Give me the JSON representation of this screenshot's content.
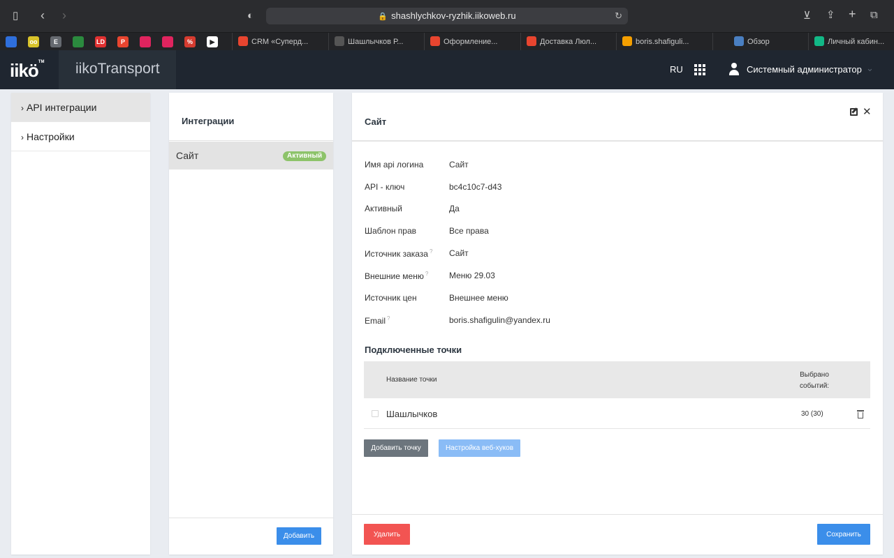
{
  "browser": {
    "url": "shashlychkov-ryzhik.iikoweb.ru",
    "pinned": [
      {
        "label": "",
        "color": "#2f6fdb"
      },
      {
        "label": "oo",
        "color": "#d9c32a"
      },
      {
        "label": "E",
        "color": "#666a70"
      },
      {
        "label": "",
        "color": "#2b8a3e"
      },
      {
        "label": "LD",
        "color": "#e03131"
      },
      {
        "label": "P",
        "color": "#e8452f"
      },
      {
        "label": "",
        "color": "#e0245e"
      },
      {
        "label": "",
        "color": "#e0245e"
      },
      {
        "label": "%",
        "color": "#d63b2f"
      },
      {
        "label": "▶",
        "color": "#ffffff"
      }
    ],
    "tabs": [
      {
        "label": "CRM «Суперд...",
        "color": "#e8452f"
      },
      {
        "label": "Шашлычков Р...",
        "color": "#555555"
      },
      {
        "label": "Оформление...",
        "color": "#e8452f"
      },
      {
        "label": "Доставка Люл...",
        "color": "#e8452f"
      },
      {
        "label": "boris.shafigulі...",
        "color": "#f59f00"
      },
      {
        "label": "Обзор",
        "color": "#4a7fc1"
      },
      {
        "label": "Личный кабин...",
        "color": "#12b886"
      }
    ]
  },
  "header": {
    "logo": "iikö",
    "logo_tm": "TM",
    "app_name": "iikoTransport",
    "lang": "RU",
    "user": "Системный администратор"
  },
  "sidebar": {
    "items": [
      {
        "label": "API интеграции"
      },
      {
        "label": "Настройки"
      }
    ]
  },
  "integrations": {
    "title": "Интеграции",
    "items": [
      {
        "label": "Сайт",
        "badge": "Активный"
      }
    ],
    "add_button": "Добавить"
  },
  "detail": {
    "title": "Сайт",
    "fields": [
      {
        "label": "Имя api логина",
        "value": "Сайт",
        "help": ""
      },
      {
        "label": "API - ключ",
        "value": "bc4c10c7-d43",
        "help": ""
      },
      {
        "label": "Активный",
        "value": "Да",
        "help": ""
      },
      {
        "label": "Шаблон прав",
        "value": "Все права",
        "help": ""
      },
      {
        "label": "Источник заказа",
        "value": "Сайт",
        "help": "?"
      },
      {
        "label": "Внешние меню",
        "value": "Меню 29.03",
        "help": "?"
      },
      {
        "label": "Источник цен",
        "value": "Внешнее меню",
        "help": ""
      },
      {
        "label": "Email",
        "value": "boris.shafigulin@yandex.ru",
        "help": "?"
      }
    ],
    "points_title": "Подключенные точки",
    "table": {
      "col_name": "Название точки",
      "col_events_1": "Выбрано",
      "col_events_2": "событий:",
      "rows": [
        {
          "name": "Шашлычков",
          "events": "30 (30)"
        }
      ]
    },
    "add_point_button": "Добавить точку",
    "webhooks_button": "Настройка веб-хуков",
    "delete_button": "Удалить",
    "save_button": "Сохранить"
  }
}
